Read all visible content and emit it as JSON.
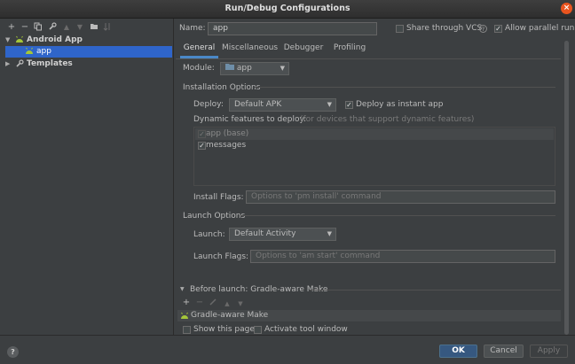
{
  "window": {
    "title": "Run/Debug Configurations",
    "close_glyph": "×"
  },
  "left": {
    "toolbar": [
      "add-icon",
      "remove-icon",
      "copy-icon",
      "wrench-icon",
      "arrow-up-icon",
      "arrow-down-icon",
      "folder-icon",
      "sort-icon"
    ],
    "tree": {
      "android_app": "Android App",
      "app": "app",
      "templates": "Templates"
    }
  },
  "config": {
    "name_label": "Name:",
    "name_value": "app",
    "share_vcs": "Share through VCS",
    "allow_parallel": "Allow parallel run"
  },
  "tabs": [
    "General",
    "Miscellaneous",
    "Debugger",
    "Profiling"
  ],
  "general": {
    "module_label": "Module:",
    "module_value": "app",
    "installation_options": "Installation Options",
    "deploy_label": "Deploy:",
    "deploy_value": "Default APK",
    "deploy_instant": "Deploy as instant app",
    "dynamic_features_label": "Dynamic features to deploy:",
    "dynamic_features_hint": "(for devices that support dynamic features)",
    "features": [
      "app (base)",
      "messages"
    ],
    "install_flags_label": "Install Flags:",
    "install_flags_placeholder": "Options to 'pm install' command",
    "launch_options": "Launch Options",
    "launch_label": "Launch:",
    "launch_value": "Default Activity",
    "launch_flags_label": "Launch Flags:",
    "launch_flags_placeholder": "Options to 'am start' command"
  },
  "before_launch": {
    "header": "Before launch: Gradle-aware Make",
    "item": "Gradle-aware Make",
    "show_page": "Show this page",
    "activate_tool": "Activate tool window"
  },
  "footer": {
    "help": "?",
    "ok": "OK",
    "cancel": "Cancel",
    "apply": "Apply"
  },
  "colors": {
    "accent": "#2f65ca",
    "tab_indicator": "#4a88c7",
    "android_green": "#a4c639",
    "close": "#e9541f"
  }
}
